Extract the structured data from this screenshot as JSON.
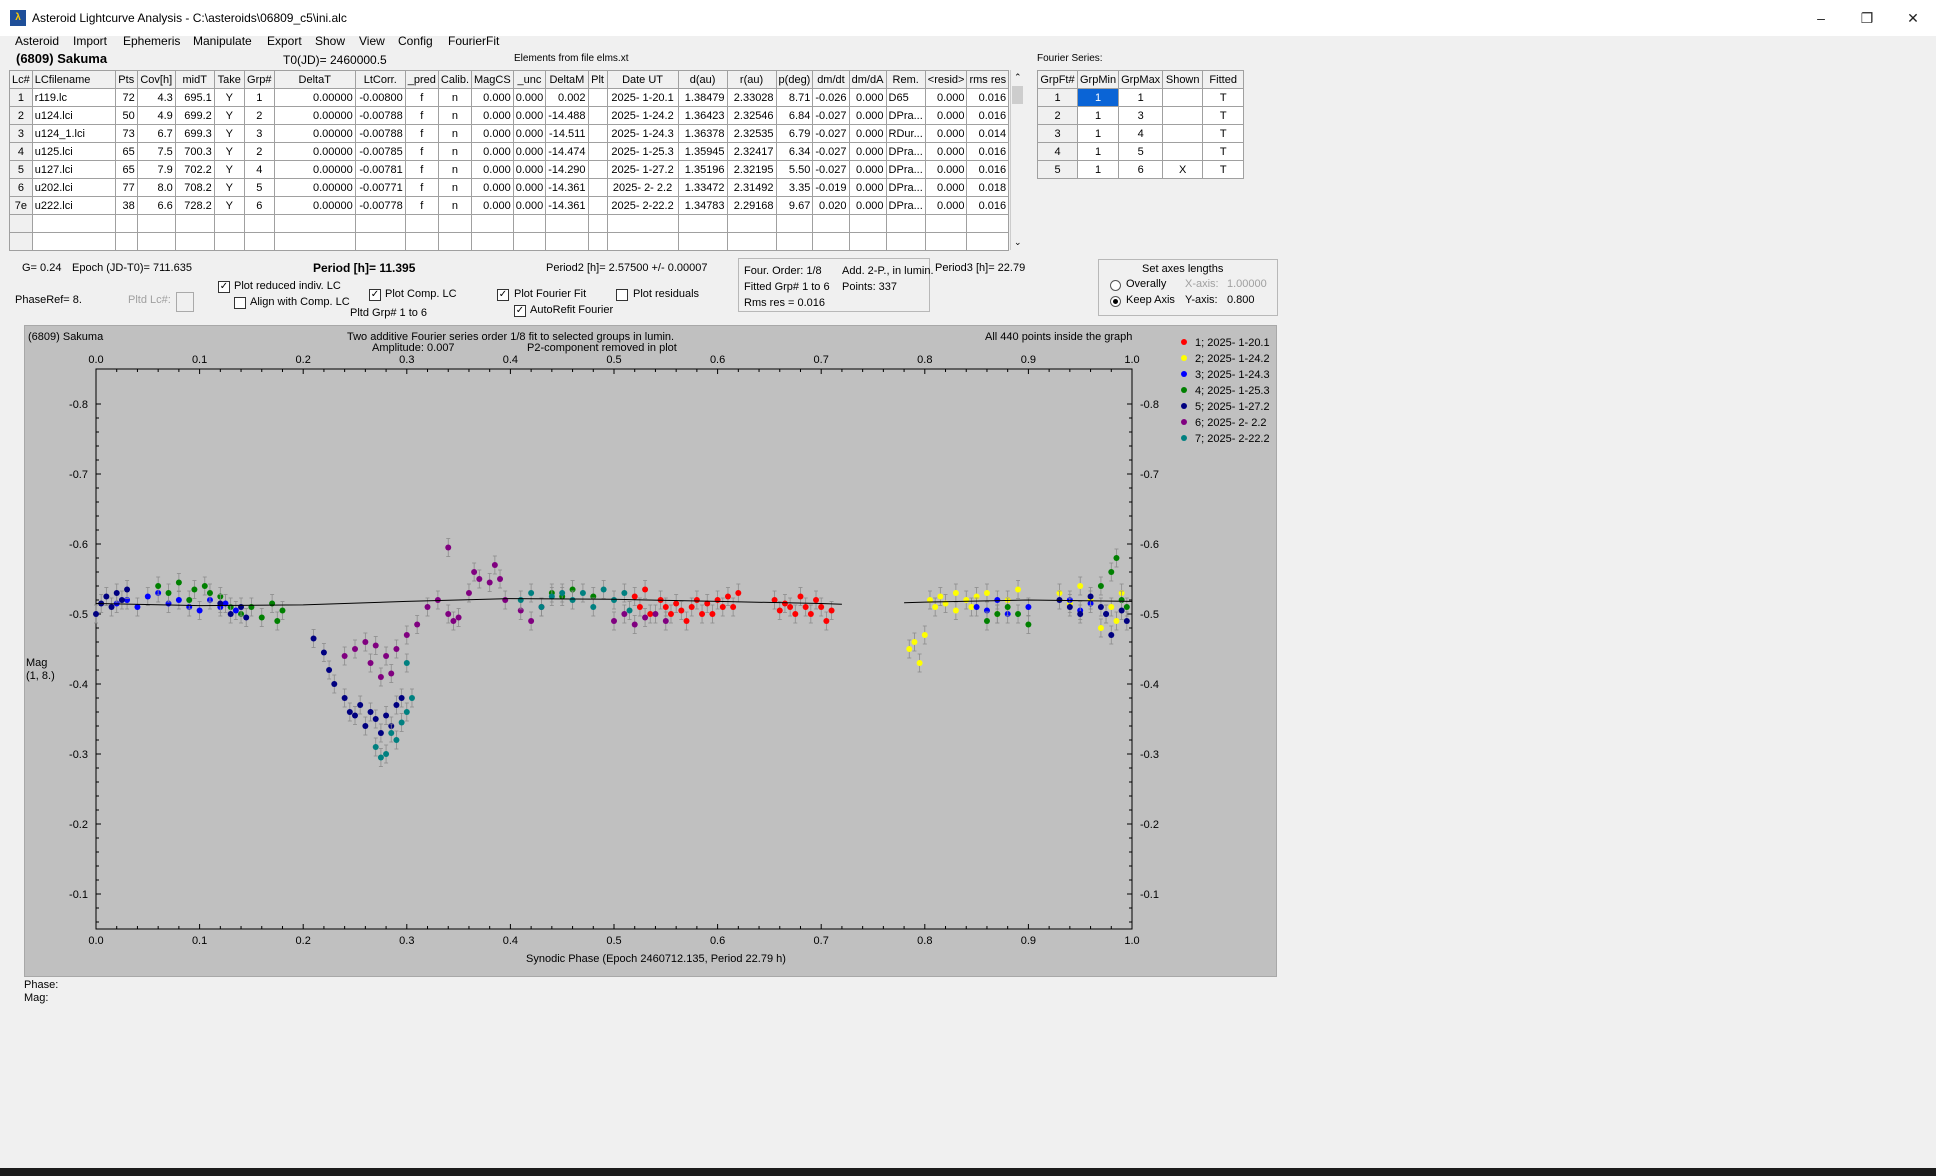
{
  "window": {
    "title": "Asteroid Lightcurve Analysis - C:\\asteroids\\06809_c5\\ini.alc",
    "controls": [
      "–",
      "❐",
      "✕"
    ]
  },
  "menu": [
    "Asteroid",
    "Import",
    "Ephemeris",
    "Manipulate",
    "Export",
    "Show",
    "View",
    "Config",
    "FourierFit"
  ],
  "header": {
    "asteroid": "(6809) Sakuma",
    "t0": "T0(JD)= 2460000.5",
    "elements": "Elements from file elms.xt",
    "fourier_series": "Fourier Series:"
  },
  "lc_table": {
    "columns": [
      "Lc#",
      "LCfilename",
      "Pts",
      "Cov[h]",
      "midT",
      "Take",
      "Grp#",
      "DeltaT",
      "LtCorr.",
      "_pred",
      "Calib.",
      "MagCS",
      "_unc",
      "DeltaM",
      "Plt",
      "Date UT",
      "d(au)",
      "r(au)",
      "p(deg)",
      "dm/dt",
      "dm/dA",
      "Rem.",
      "<resid>",
      "rms res"
    ],
    "rows": [
      [
        "1",
        "r119.lc",
        "72",
        "4.3",
        "695.1",
        "Y",
        "1",
        "0.00000",
        "-0.00800",
        "f",
        "n",
        "0.000",
        "0.000",
        "0.002",
        "",
        "2025- 1-20.1",
        "1.38479",
        "2.33028",
        "8.71",
        "-0.026",
        "0.000",
        "D65",
        "0.000",
        "0.016"
      ],
      [
        "2",
        "u124.lci",
        "50",
        "4.9",
        "699.2",
        "Y",
        "2",
        "0.00000",
        "-0.00788",
        "f",
        "n",
        "0.000",
        "0.000",
        "-14.488",
        "",
        "2025- 1-24.2",
        "1.36423",
        "2.32546",
        "6.84",
        "-0.027",
        "0.000",
        "DPra...",
        "0.000",
        "0.016"
      ],
      [
        "3",
        "u124_1.lci",
        "73",
        "6.7",
        "699.3",
        "Y",
        "3",
        "0.00000",
        "-0.00788",
        "f",
        "n",
        "0.000",
        "0.000",
        "-14.511",
        "",
        "2025- 1-24.3",
        "1.36378",
        "2.32535",
        "6.79",
        "-0.027",
        "0.000",
        "RDur...",
        "0.000",
        "0.014"
      ],
      [
        "4",
        "u125.lci",
        "65",
        "7.5",
        "700.3",
        "Y",
        "2",
        "0.00000",
        "-0.00785",
        "f",
        "n",
        "0.000",
        "0.000",
        "-14.474",
        "",
        "2025- 1-25.3",
        "1.35945",
        "2.32417",
        "6.34",
        "-0.027",
        "0.000",
        "DPra...",
        "0.000",
        "0.016"
      ],
      [
        "5",
        "u127.lci",
        "65",
        "7.9",
        "702.2",
        "Y",
        "4",
        "0.00000",
        "-0.00781",
        "f",
        "n",
        "0.000",
        "0.000",
        "-14.290",
        "",
        "2025- 1-27.2",
        "1.35196",
        "2.32195",
        "5.50",
        "-0.027",
        "0.000",
        "DPra...",
        "0.000",
        "0.016"
      ],
      [
        "6",
        "u202.lci",
        "77",
        "8.0",
        "708.2",
        "Y",
        "5",
        "0.00000",
        "-0.00771",
        "f",
        "n",
        "0.000",
        "0.000",
        "-14.361",
        "",
        "2025- 2- 2.2",
        "1.33472",
        "2.31492",
        "3.35",
        "-0.019",
        "0.000",
        "DPra...",
        "0.000",
        "0.018"
      ],
      [
        "7e",
        "u222.lci",
        "38",
        "6.6",
        "728.2",
        "Y",
        "6",
        "0.00000",
        "-0.00778",
        "f",
        "n",
        "0.000",
        "0.000",
        "-14.361",
        "",
        "2025- 2-22.2",
        "1.34783",
        "2.29168",
        "9.67",
        "0.020",
        "0.000",
        "DPra...",
        "0.000",
        "0.016"
      ]
    ]
  },
  "fourier_table": {
    "columns": [
      "GrpFt#",
      "GrpMin",
      "GrpMax",
      "Shown",
      "Fitted"
    ],
    "rows": [
      [
        "1",
        "1",
        "1",
        "",
        "T"
      ],
      [
        "2",
        "1",
        "3",
        "",
        "T"
      ],
      [
        "3",
        "1",
        "4",
        "",
        "T"
      ],
      [
        "4",
        "1",
        "5",
        "",
        "T"
      ],
      [
        "5",
        "1",
        "6",
        "X",
        "T"
      ]
    ]
  },
  "controls": {
    "g": "G= 0.24",
    "epoch": "Epoch (JD-T0)= 711.635",
    "period": "Period [h]= 11.395",
    "period2": "Period2 [h]= 2.57500 +/- 0.00007",
    "period3": "Period3 [h]= 22.79",
    "four_order": "Four. Order:  1/8",
    "add2p": "Add. 2-P., in lumin.",
    "fitted_grp": "Fitted Grp# 1 to 6",
    "points": "Points: 337",
    "rms": "Rms res    = 0.016",
    "phase_ref": "PhaseRef= 8.",
    "pltd_lc": "Pltd Lc#:",
    "plot_reduced": "Plot reduced indiv. LC",
    "align_comp": "Align with Comp. LC",
    "plot_comp": "Plot Comp. LC",
    "pltd_grp": "Pltd Grp#  1   to   6",
    "plot_fourier": "Plot Fourier Fit",
    "autorefit": "AutoRefit Fourier",
    "plot_residuals": "Plot residuals",
    "set_axes": "Set axes lengths",
    "overally": "Overally",
    "keep_axis": "Keep Axis",
    "x_axis_label": "X-axis:",
    "x_axis_val": "1.00000",
    "y_axis_label": "Y-axis:",
    "y_axis_val": "0.800"
  },
  "plot_text": {
    "name": "(6809) Sakuma",
    "desc1": "Two additive Fourier series order 1/8 fit to selected groups in lumin.",
    "amp": "Amplitude: 0.007",
    "p2": "P2-component removed in plot",
    "allpts": "All 440 points inside the graph",
    "ylabel1": "Mag",
    "ylabel2": "(1, 8.)",
    "xlabel": "Synodic Phase (Epoch 2460712.135, Period 22.79 h)"
  },
  "bottom": {
    "phase": "Phase:",
    "mag": "Mag:"
  },
  "chart_data": {
    "type": "scatter",
    "xlabel": "Synodic Phase (Epoch 2460712.135, Period 22.79 h)",
    "ylabel": "Mag (1, 8.)",
    "xlim": [
      0.0,
      1.0
    ],
    "ylim": [
      -0.85,
      -0.05
    ],
    "y_inverted": true,
    "x_ticks": [
      "0.0",
      "0.1",
      "0.2",
      "0.3",
      "0.4",
      "0.5",
      "0.6",
      "0.7",
      "0.8",
      "0.9",
      "1.0"
    ],
    "y_ticks": [
      "-0.8",
      "-0.7",
      "-0.6",
      "-0.5",
      "-0.4",
      "-0.3",
      "-0.2",
      "-0.1"
    ],
    "legend_position": "right",
    "series": [
      {
        "name": "1; 2025- 1-20.1",
        "color": "#ff0000",
        "points": [
          [
            0.655,
            -0.52
          ],
          [
            0.66,
            -0.505
          ],
          [
            0.665,
            -0.515
          ],
          [
            0.67,
            -0.51
          ],
          [
            0.675,
            -0.5
          ],
          [
            0.68,
            -0.525
          ],
          [
            0.685,
            -0.51
          ],
          [
            0.69,
            -0.5
          ],
          [
            0.695,
            -0.52
          ],
          [
            0.7,
            -0.51
          ],
          [
            0.705,
            -0.49
          ],
          [
            0.71,
            -0.505
          ],
          [
            0.59,
            -0.515
          ],
          [
            0.595,
            -0.5
          ],
          [
            0.6,
            -0.52
          ],
          [
            0.605,
            -0.51
          ],
          [
            0.61,
            -0.525
          ],
          [
            0.615,
            -0.51
          ],
          [
            0.62,
            -0.53
          ],
          [
            0.565,
            -0.505
          ],
          [
            0.57,
            -0.49
          ],
          [
            0.575,
            -0.51
          ],
          [
            0.58,
            -0.52
          ],
          [
            0.585,
            -0.5
          ],
          [
            0.545,
            -0.52
          ],
          [
            0.55,
            -0.51
          ],
          [
            0.555,
            -0.5
          ],
          [
            0.56,
            -0.515
          ],
          [
            0.52,
            -0.525
          ],
          [
            0.525,
            -0.51
          ],
          [
            0.53,
            -0.535
          ],
          [
            0.535,
            -0.5
          ]
        ]
      },
      {
        "name": "2; 2025- 1-24.2",
        "color": "#ffff00",
        "points": [
          [
            0.785,
            -0.45
          ],
          [
            0.79,
            -0.46
          ],
          [
            0.795,
            -0.43
          ],
          [
            0.8,
            -0.47
          ],
          [
            0.805,
            -0.52
          ],
          [
            0.81,
            -0.51
          ],
          [
            0.815,
            -0.525
          ],
          [
            0.82,
            -0.515
          ],
          [
            0.83,
            -0.53
          ],
          [
            0.84,
            -0.52
          ],
          [
            0.85,
            -0.525
          ],
          [
            0.86,
            -0.53
          ],
          [
            0.87,
            -0.5
          ],
          [
            0.88,
            -0.52
          ],
          [
            0.89,
            -0.535
          ],
          [
            0.93,
            -0.53
          ],
          [
            0.94,
            -0.515
          ],
          [
            0.95,
            -0.54
          ],
          [
            0.96,
            -0.52
          ],
          [
            0.97,
            -0.48
          ],
          [
            0.98,
            -0.51
          ],
          [
            0.985,
            -0.49
          ],
          [
            0.99,
            -0.53
          ],
          [
            0.83,
            -0.505
          ],
          [
            0.845,
            -0.51
          ]
        ]
      },
      {
        "name": "3; 2025- 1-24.3",
        "color": "#0000ff",
        "points": [
          [
            0.02,
            -0.515
          ],
          [
            0.03,
            -0.52
          ],
          [
            0.04,
            -0.51
          ],
          [
            0.05,
            -0.525
          ],
          [
            0.06,
            -0.53
          ],
          [
            0.07,
            -0.515
          ],
          [
            0.08,
            -0.52
          ],
          [
            0.09,
            -0.51
          ],
          [
            0.1,
            -0.505
          ],
          [
            0.11,
            -0.52
          ],
          [
            0.12,
            -0.51
          ],
          [
            0.125,
            -0.515
          ],
          [
            0.135,
            -0.505
          ],
          [
            0.85,
            -0.51
          ],
          [
            0.86,
            -0.505
          ],
          [
            0.87,
            -0.52
          ],
          [
            0.88,
            -0.5
          ],
          [
            0.9,
            -0.51
          ],
          [
            0.94,
            -0.52
          ],
          [
            0.95,
            -0.505
          ],
          [
            0.96,
            -0.515
          ],
          [
            0.975,
            -0.5
          ]
        ]
      },
      {
        "name": "4; 2025- 1-25.3",
        "color": "#008000",
        "points": [
          [
            0.06,
            -0.54
          ],
          [
            0.07,
            -0.53
          ],
          [
            0.08,
            -0.545
          ],
          [
            0.09,
            -0.52
          ],
          [
            0.095,
            -0.535
          ],
          [
            0.105,
            -0.54
          ],
          [
            0.11,
            -0.53
          ],
          [
            0.12,
            -0.525
          ],
          [
            0.13,
            -0.51
          ],
          [
            0.14,
            -0.5
          ],
          [
            0.15,
            -0.51
          ],
          [
            0.16,
            -0.495
          ],
          [
            0.17,
            -0.515
          ],
          [
            0.175,
            -0.49
          ],
          [
            0.18,
            -0.505
          ],
          [
            0.86,
            -0.49
          ],
          [
            0.87,
            -0.5
          ],
          [
            0.88,
            -0.51
          ],
          [
            0.89,
            -0.5
          ],
          [
            0.9,
            -0.485
          ],
          [
            0.97,
            -0.54
          ],
          [
            0.98,
            -0.56
          ],
          [
            0.985,
            -0.58
          ],
          [
            0.99,
            -0.52
          ],
          [
            0.995,
            -0.51
          ],
          [
            0.44,
            -0.53
          ],
          [
            0.45,
            -0.525
          ],
          [
            0.46,
            -0.535
          ],
          [
            0.48,
            -0.525
          ]
        ]
      },
      {
        "name": "5; 2025- 1-27.2",
        "color": "#000080",
        "points": [
          [
            0.0,
            -0.5
          ],
          [
            0.005,
            -0.515
          ],
          [
            0.01,
            -0.525
          ],
          [
            0.015,
            -0.51
          ],
          [
            0.02,
            -0.53
          ],
          [
            0.025,
            -0.52
          ],
          [
            0.03,
            -0.535
          ],
          [
            0.12,
            -0.515
          ],
          [
            0.13,
            -0.5
          ],
          [
            0.14,
            -0.51
          ],
          [
            0.145,
            -0.495
          ],
          [
            0.21,
            -0.465
          ],
          [
            0.22,
            -0.445
          ],
          [
            0.225,
            -0.42
          ],
          [
            0.23,
            -0.4
          ],
          [
            0.24,
            -0.38
          ],
          [
            0.245,
            -0.36
          ],
          [
            0.25,
            -0.355
          ],
          [
            0.255,
            -0.37
          ],
          [
            0.26,
            -0.34
          ],
          [
            0.265,
            -0.36
          ],
          [
            0.27,
            -0.35
          ],
          [
            0.275,
            -0.33
          ],
          [
            0.28,
            -0.355
          ],
          [
            0.285,
            -0.34
          ],
          [
            0.29,
            -0.37
          ],
          [
            0.295,
            -0.38
          ],
          [
            0.93,
            -0.52
          ],
          [
            0.94,
            -0.51
          ],
          [
            0.95,
            -0.5
          ],
          [
            0.96,
            -0.525
          ],
          [
            0.97,
            -0.51
          ],
          [
            0.975,
            -0.5
          ],
          [
            0.98,
            -0.47
          ],
          [
            0.99,
            -0.505
          ],
          [
            0.995,
            -0.49
          ]
        ]
      },
      {
        "name": "6; 2025- 2- 2.2",
        "color": "#800080",
        "points": [
          [
            0.24,
            -0.44
          ],
          [
            0.25,
            -0.45
          ],
          [
            0.26,
            -0.46
          ],
          [
            0.265,
            -0.43
          ],
          [
            0.27,
            -0.455
          ],
          [
            0.275,
            -0.41
          ],
          [
            0.28,
            -0.44
          ],
          [
            0.285,
            -0.415
          ],
          [
            0.29,
            -0.45
          ],
          [
            0.3,
            -0.47
          ],
          [
            0.31,
            -0.485
          ],
          [
            0.32,
            -0.51
          ],
          [
            0.33,
            -0.52
          ],
          [
            0.34,
            -0.5
          ],
          [
            0.345,
            -0.49
          ],
          [
            0.35,
            -0.495
          ],
          [
            0.34,
            -0.595
          ],
          [
            0.36,
            -0.53
          ],
          [
            0.365,
            -0.56
          ],
          [
            0.37,
            -0.55
          ],
          [
            0.38,
            -0.545
          ],
          [
            0.385,
            -0.57
          ],
          [
            0.39,
            -0.55
          ],
          [
            0.395,
            -0.52
          ],
          [
            0.41,
            -0.505
          ],
          [
            0.42,
            -0.49
          ],
          [
            0.43,
            -0.51
          ],
          [
            0.5,
            -0.49
          ],
          [
            0.51,
            -0.5
          ],
          [
            0.52,
            -0.485
          ],
          [
            0.53,
            -0.495
          ],
          [
            0.54,
            -0.5
          ],
          [
            0.55,
            -0.49
          ]
        ]
      },
      {
        "name": "7; 2025- 2-22.2",
        "color": "#008080",
        "points": [
          [
            0.27,
            -0.31
          ],
          [
            0.275,
            -0.295
          ],
          [
            0.28,
            -0.3
          ],
          [
            0.285,
            -0.33
          ],
          [
            0.29,
            -0.32
          ],
          [
            0.295,
            -0.345
          ],
          [
            0.3,
            -0.36
          ],
          [
            0.305,
            -0.38
          ],
          [
            0.3,
            -0.43
          ],
          [
            0.41,
            -0.52
          ],
          [
            0.42,
            -0.53
          ],
          [
            0.43,
            -0.51
          ],
          [
            0.44,
            -0.525
          ],
          [
            0.45,
            -0.53
          ],
          [
            0.46,
            -0.52
          ],
          [
            0.47,
            -0.53
          ],
          [
            0.48,
            -0.51
          ],
          [
            0.49,
            -0.535
          ],
          [
            0.5,
            -0.52
          ],
          [
            0.51,
            -0.53
          ],
          [
            0.515,
            -0.505
          ]
        ]
      }
    ],
    "fourier_fit": [
      [
        0.0,
        -0.515
      ],
      [
        0.1,
        -0.512
      ],
      [
        0.2,
        -0.513
      ],
      [
        0.3,
        -0.518
      ],
      [
        0.4,
        -0.522
      ],
      [
        0.5,
        -0.521
      ],
      [
        0.6,
        -0.518
      ],
      [
        0.7,
        -0.515
      ],
      [
        0.72,
        -0.514
      ],
      [
        0.78,
        -0.516
      ],
      [
        0.8,
        -0.517
      ],
      [
        0.9,
        -0.52
      ],
      [
        1.0,
        -0.518
      ]
    ]
  }
}
